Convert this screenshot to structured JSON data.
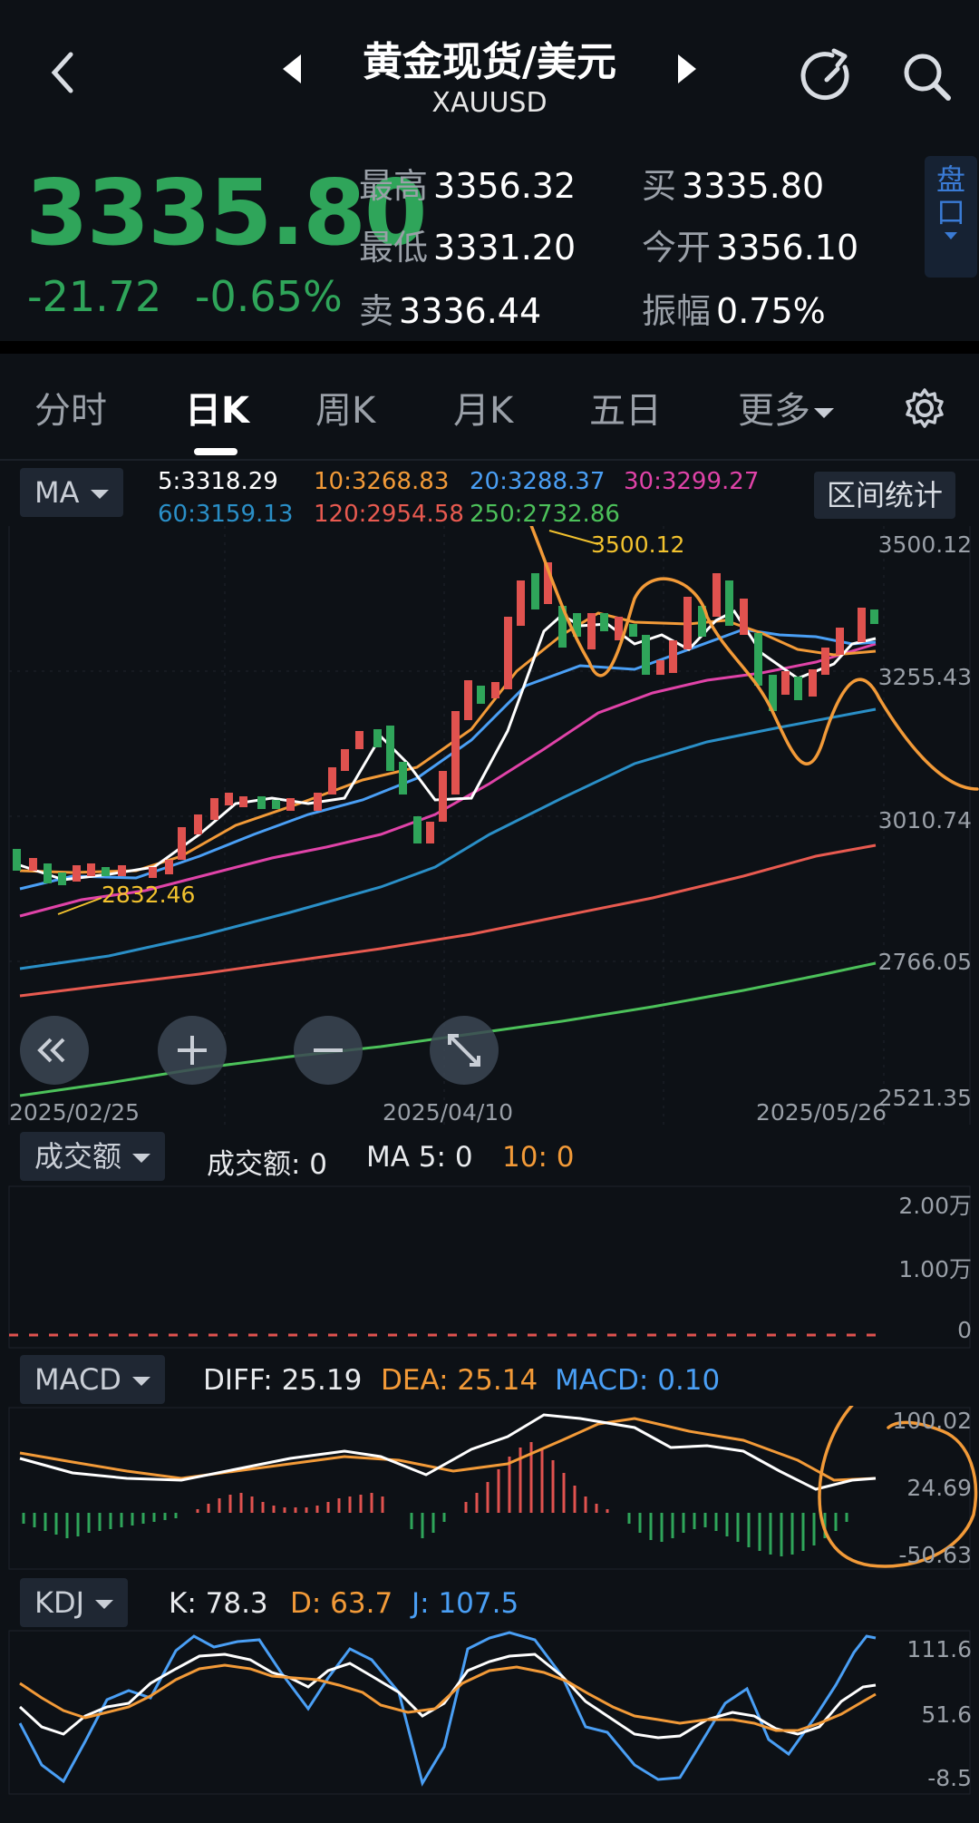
{
  "header": {
    "title": "黄金现货/美元",
    "symbol": "XAUUSD"
  },
  "quote": {
    "price": "3335.80",
    "change": "-21.72",
    "change_pct": "-0.65%",
    "high_label": "最高",
    "high": "3356.32",
    "low_label": "最低",
    "low": "3331.20",
    "sell_label": "卖",
    "sell": "3336.44",
    "buy_label": "买",
    "buy": "3335.80",
    "open_label": "今开",
    "open": "3356.10",
    "amp_label": "振幅",
    "amp": "0.75%",
    "pankou_label": "盘口"
  },
  "tabs": [
    {
      "label": "分时"
    },
    {
      "label": "日K",
      "active": true
    },
    {
      "label": "周K"
    },
    {
      "label": "月K"
    },
    {
      "label": "五日"
    },
    {
      "label": "更多"
    }
  ],
  "ma_panel": {
    "selector": "MA",
    "ma5": "5:3318.29",
    "ma10": "10:3268.83",
    "ma20": "20:3288.37",
    "ma30": "30:3299.27",
    "ma60": "60:3159.13",
    "ma120": "120:2954.58",
    "ma250": "250:2732.86",
    "range_btn": "区间统计",
    "high_mark": "3500.12",
    "low_mark": "2832.46",
    "y_labels": [
      "3500.12",
      "3255.43",
      "3010.74",
      "2766.05",
      "2521.35"
    ],
    "x_labels": [
      "2025/02/25",
      "2025/04/10",
      "2025/05/26"
    ]
  },
  "volume_panel": {
    "selector": "成交额",
    "value": "成交额: 0",
    "ma5": "MA 5: 0",
    "ma10": "10: 0",
    "y_labels": [
      "2.00万",
      "1.00万",
      "0"
    ]
  },
  "macd_panel": {
    "selector": "MACD",
    "diff": "DIFF: 25.19",
    "dea": "DEA: 25.14",
    "macd": "MACD: 0.10",
    "y_labels": [
      "100.02",
      "24.69",
      "-50.63"
    ]
  },
  "kdj_panel": {
    "selector": "KDJ",
    "k": "K: 78.3",
    "d": "D: 63.7",
    "j": "J: 107.5",
    "y_labels": [
      "111.6",
      "51.6",
      "-8.5"
    ]
  },
  "colors": {
    "up": "#e0524f",
    "down": "#2fa55a",
    "ma5": "#ffffff",
    "ma10": "#f29a38",
    "ma20": "#4a9ff5",
    "ma30": "#e043a8",
    "ma60": "#2a8fc7",
    "ma120": "#e85a50",
    "ma250": "#4cc15a",
    "annotation": "#f29a38"
  }
}
